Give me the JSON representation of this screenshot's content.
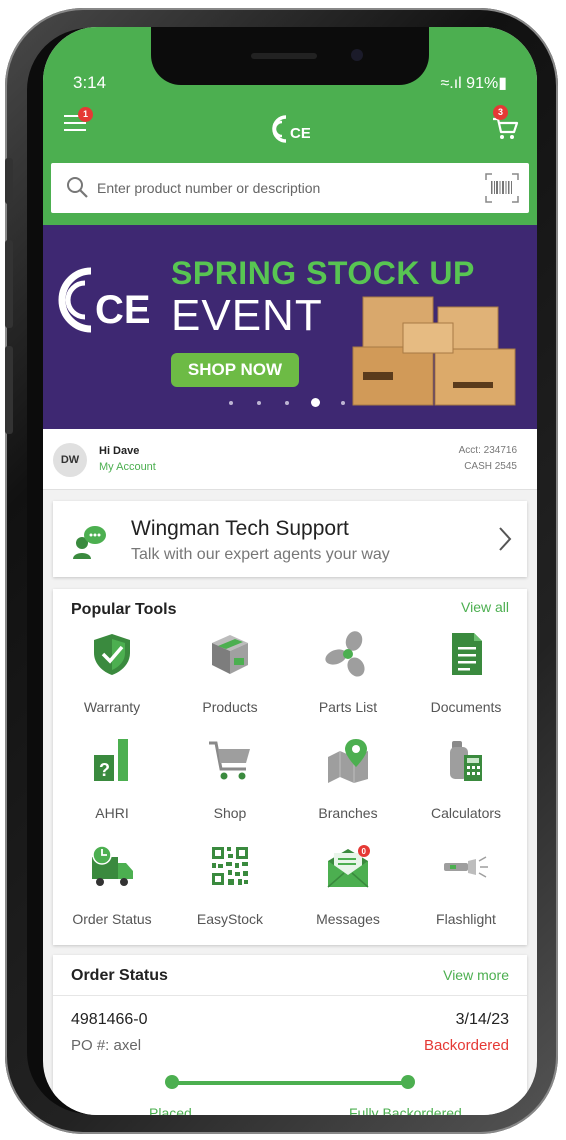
{
  "status_bar": {
    "time": "3:14",
    "signal": "≈.ıl 91%▮"
  },
  "app_bar": {
    "menu_badge": "1",
    "cart_badge": "3",
    "logo_text": "CE"
  },
  "search": {
    "placeholder": "Enter product number or description"
  },
  "banner": {
    "logo_text": "CE",
    "headline": "SPRING STOCK UP",
    "subheadline": "EVENT",
    "cta": "SHOP NOW",
    "slide_count": 5,
    "active_slide": 4
  },
  "account": {
    "initials": "DW",
    "greeting": "Hi Dave",
    "link": "My Account",
    "acct": "Acct: 234716",
    "cash": "CASH 2545"
  },
  "wingman": {
    "title": "Wingman Tech Support",
    "subtitle": "Talk with our expert agents your way"
  },
  "tools": {
    "title": "Popular Tools",
    "view_all": "View all",
    "items": [
      {
        "label": "Warranty",
        "icon": "shield-check-icon"
      },
      {
        "label": "Products",
        "icon": "box-icon"
      },
      {
        "label": "Parts List",
        "icon": "fan-icon"
      },
      {
        "label": "Documents",
        "icon": "document-icon"
      },
      {
        "label": "AHRI",
        "icon": "ahri-chart-icon"
      },
      {
        "label": "Shop",
        "icon": "cart-icon"
      },
      {
        "label": "Branches",
        "icon": "map-pin-icon"
      },
      {
        "label": "Calculators",
        "icon": "calculator-icon"
      },
      {
        "label": "Order Status",
        "icon": "truck-clock-icon"
      },
      {
        "label": "EasyStock",
        "icon": "qr-code-icon"
      },
      {
        "label": "Messages",
        "icon": "envelope-icon"
      },
      {
        "label": "Flashlight",
        "icon": "flashlight-icon"
      }
    ],
    "messages_badge": "0"
  },
  "order_status": {
    "title": "Order Status",
    "view_more": "View more",
    "order_number": "4981466-0",
    "date": "3/14/23",
    "po": "PO #: axel",
    "status": "Backordered",
    "steps": [
      "Placed",
      "Fully Backordered"
    ]
  },
  "colors": {
    "brand_green": "#4caf50",
    "banner_purple": "#3e2872",
    "alert_red": "#e53935"
  }
}
